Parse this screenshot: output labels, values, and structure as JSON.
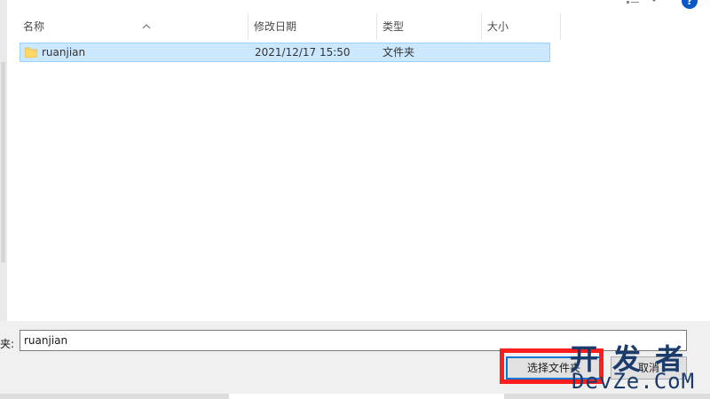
{
  "columns": [
    "名称",
    "修改日期",
    "类型",
    "大小"
  ],
  "files": [
    {
      "name": "ruanjian",
      "modified": "2021/12/17 15:50",
      "type": "文件夹",
      "size": ""
    }
  ],
  "folder_field": {
    "label": "夹:",
    "value": "ruanjian"
  },
  "buttons": {
    "select_folder": "选择文件夹",
    "cancel": "取消"
  },
  "toolbar": {
    "help_glyph": "?"
  },
  "watermark": {
    "line1": "开发者",
    "line2": "DevZe.CoM"
  },
  "colors": {
    "selection": "#cce8ff",
    "selection_border": "#99d1ff",
    "annotation": "#ff1e1e",
    "help": "#0a58c7"
  },
  "icons": [
    "folder-icon",
    "sort-ascending-icon",
    "view-options-icon",
    "chevron-down-icon",
    "help-icon"
  ]
}
